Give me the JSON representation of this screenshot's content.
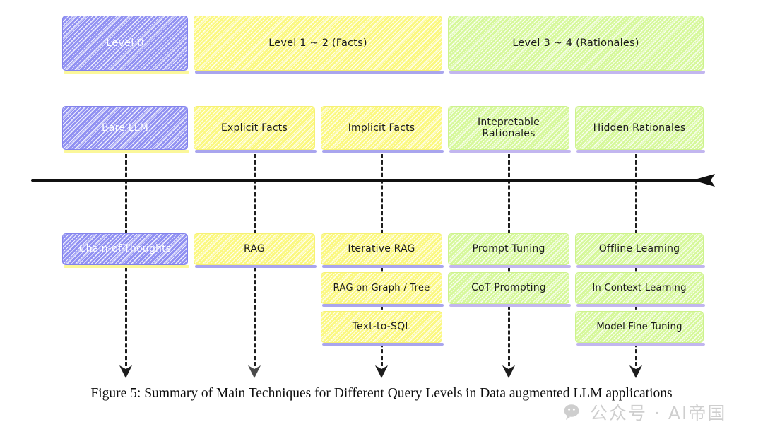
{
  "figure": {
    "caption": "Figure 5: Summary of Main Techniques for Different Query Levels in Data augmented LLM applications"
  },
  "watermark": {
    "text": "公众号 · AI帝国",
    "icon": "wechat-icon"
  },
  "axis": {
    "label": "",
    "arrow_direction": "right"
  },
  "colors": {
    "purple": "#9191f2",
    "yellow": "#fbf881",
    "green": "#d6f89b",
    "purple_shadow": "#a9a5ee",
    "yellow_shadow": "#fbf79a",
    "text_dark": "#1b1b1b",
    "text_light": "#ffffff",
    "axis": "#111111"
  },
  "header_row": [
    {
      "label": "Level 0",
      "color": "purple",
      "text_color": "light"
    },
    {
      "label": "Level 1 ~ 2 (Facts)",
      "color": "yellow",
      "text_color": "dark"
    },
    {
      "label": "Level 3 ~ 4 (Rationales)",
      "color": "green",
      "text_color": "dark"
    }
  ],
  "category_row": [
    {
      "label": "Bare LLM",
      "color": "purple",
      "text_color": "light"
    },
    {
      "label": "Explicit Facts",
      "color": "yellow",
      "text_color": "dark"
    },
    {
      "label": "Implicit Facts",
      "color": "yellow",
      "text_color": "dark"
    },
    {
      "label": "Intepretable\nRationales",
      "color": "green",
      "text_color": "dark"
    },
    {
      "label": "Hidden Rationales",
      "color": "green",
      "text_color": "dark"
    }
  ],
  "technique_columns": [
    {
      "column": 1,
      "items": [
        {
          "label": "Chain-of-Thoughts",
          "color": "purple",
          "text_color": "light"
        }
      ]
    },
    {
      "column": 2,
      "items": [
        {
          "label": "RAG",
          "color": "yellow",
          "text_color": "dark"
        }
      ]
    },
    {
      "column": 3,
      "items": [
        {
          "label": "Iterative RAG",
          "color": "yellow",
          "text_color": "dark"
        },
        {
          "label": "RAG on Graph / Tree",
          "color": "yellow",
          "text_color": "dark"
        },
        {
          "label": "Text-to-SQL",
          "color": "yellow",
          "text_color": "dark"
        }
      ]
    },
    {
      "column": 4,
      "items": [
        {
          "label": "Prompt Tuning",
          "color": "green",
          "text_color": "dark"
        },
        {
          "label": "CoT Prompting",
          "color": "green",
          "text_color": "dark"
        }
      ]
    },
    {
      "column": 5,
      "items": [
        {
          "label": "Offline Learning",
          "color": "green",
          "text_color": "dark"
        },
        {
          "label": "In Context Learning",
          "color": "green",
          "text_color": "dark"
        },
        {
          "label": "Model Fine Tuning",
          "color": "green",
          "text_color": "dark"
        }
      ]
    }
  ]
}
